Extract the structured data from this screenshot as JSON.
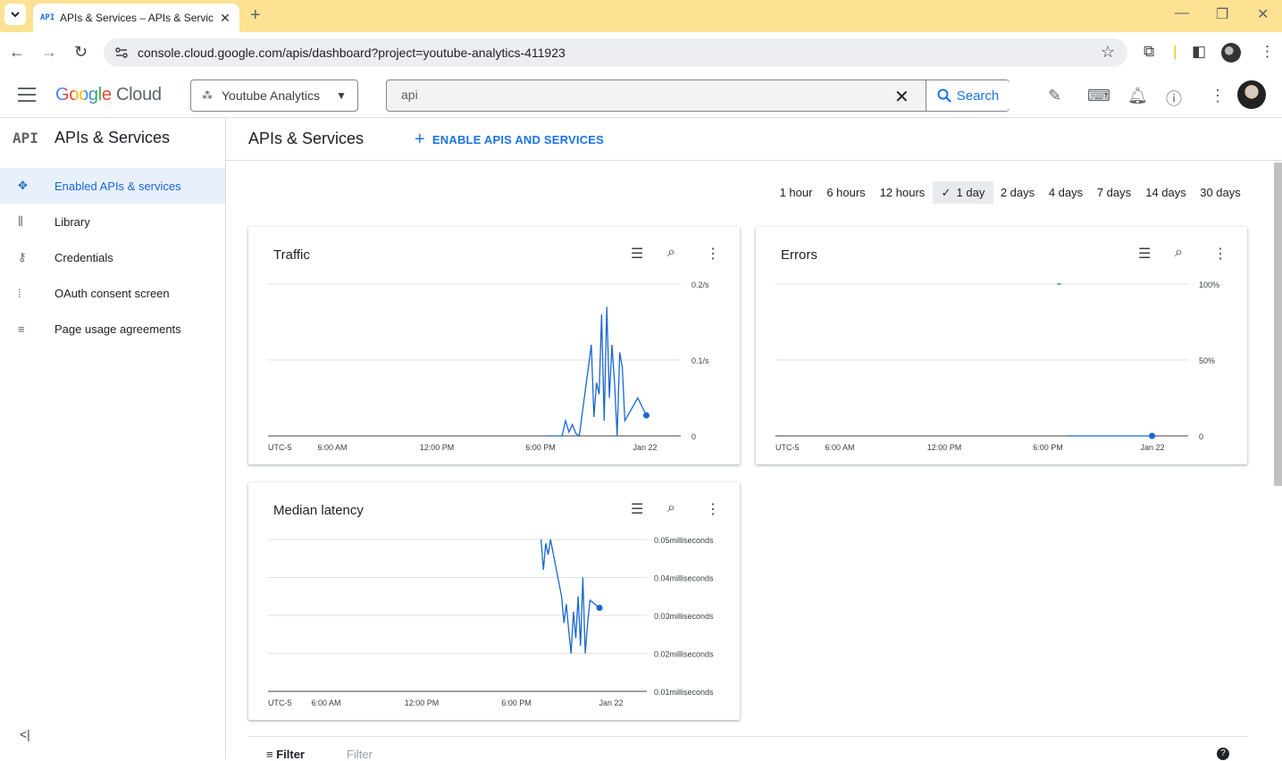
{
  "browser": {
    "tab_title": "APIs & Services – APIs & Servic",
    "tab_favicon": "API",
    "url": "console.cloud.google.com/apis/dashboard?project=youtube-analytics-411923"
  },
  "header": {
    "logo_google": "Google",
    "logo_cloud": "Cloud",
    "project": "Youtube Analytics",
    "search_value": "api",
    "search_button": "Search"
  },
  "sidebar": {
    "icon": "API",
    "title": "APIs & Services",
    "items": [
      {
        "label": "Enabled APIs & services",
        "icon": "diamond-nodes-icon",
        "glyph": "✥",
        "active": true
      },
      {
        "label": "Library",
        "icon": "library-icon",
        "glyph": "⫼",
        "active": false
      },
      {
        "label": "Credentials",
        "icon": "key-icon",
        "glyph": "⚷",
        "active": false
      },
      {
        "label": "OAuth consent screen",
        "icon": "oauth-icon",
        "glyph": "⁞",
        "active": false
      },
      {
        "label": "Page usage agreements",
        "icon": "settings-list-icon",
        "glyph": "≡",
        "active": false
      }
    ],
    "collapse_glyph": "<|"
  },
  "main": {
    "title": "APIs & Services",
    "enable_button": "ENABLE APIS AND SERVICES",
    "time_ranges": [
      "1 hour",
      "6 hours",
      "12 hours",
      "1 day",
      "2 days",
      "4 days",
      "7 days",
      "14 days",
      "30 days"
    ],
    "selected_range": "1 day"
  },
  "filter": {
    "label": "Filter",
    "placeholder": "Filter"
  },
  "chart_data": [
    {
      "type": "line",
      "title": "Traffic",
      "x_ticks": [
        "UTC-5",
        "6:00 AM",
        "12:00 PM",
        "6:00 PM",
        "Jan 22"
      ],
      "y_ticks": [
        "0",
        "0.1/s",
        "0.2/s"
      ],
      "ylim": [
        0,
        0.2
      ],
      "grid": true,
      "series": [
        {
          "color": "#1967d2",
          "x_hours": [
            16.2,
            17.1,
            17.3,
            17.5,
            17.7,
            17.9,
            18.1,
            18.8,
            18.95,
            19.1,
            19.25,
            19.4,
            19.55,
            19.7,
            19.85,
            20.0,
            20.15,
            20.3,
            20.45,
            20.6,
            20.75,
            21.5,
            22.0
          ],
          "values": [
            0.0,
            0.0,
            0.02,
            0.005,
            0.015,
            0.003,
            0.0,
            0.12,
            0.025,
            0.07,
            0.055,
            0.16,
            0.02,
            0.17,
            0.05,
            0.12,
            0.07,
            0.0,
            0.11,
            0.09,
            0.02,
            0.05,
            0.027
          ],
          "last_point": [
            22.0,
            0.027
          ]
        }
      ]
    },
    {
      "type": "line",
      "title": "Errors",
      "x_ticks": [
        "UTC-5",
        "6:00 AM",
        "12:00 PM",
        "6:00 PM",
        "Jan 22"
      ],
      "y_ticks": [
        "0",
        "50%",
        "100%"
      ],
      "ylim": [
        0,
        100
      ],
      "grid": true,
      "series": [
        {
          "color": "#1967d2",
          "x_hours": [
            17.0,
            21.9
          ],
          "values": [
            0,
            0
          ],
          "last_point": [
            21.9,
            0
          ],
          "extra_point": [
            16.5,
            100
          ]
        }
      ]
    },
    {
      "type": "line",
      "title": "Median latency",
      "x_ticks": [
        "UTC-5",
        "6:00 AM",
        "12:00 PM",
        "6:00 PM",
        "Jan 22"
      ],
      "y_ticks": [
        "0.01milliseconds",
        "0.02milliseconds",
        "0.03milliseconds",
        "0.04milliseconds",
        "0.05milliseconds"
      ],
      "ylim": [
        0.01,
        0.05
      ],
      "grid": true,
      "series": [
        {
          "color": "#1967d2",
          "x_hours": [
            17.3,
            17.45,
            17.6,
            17.75,
            17.9,
            18.6,
            18.75,
            18.9,
            19.05,
            19.2,
            19.35,
            19.5,
            19.65,
            19.8,
            19.95,
            20.1,
            20.25,
            20.4,
            21.0
          ],
          "values": [
            0.05,
            0.042,
            0.049,
            0.046,
            0.05,
            0.035,
            0.028,
            0.033,
            0.026,
            0.02,
            0.031,
            0.024,
            0.035,
            0.022,
            0.04,
            0.02,
            0.028,
            0.034,
            0.032
          ],
          "last_point": [
            21.0,
            0.032
          ]
        }
      ]
    }
  ]
}
